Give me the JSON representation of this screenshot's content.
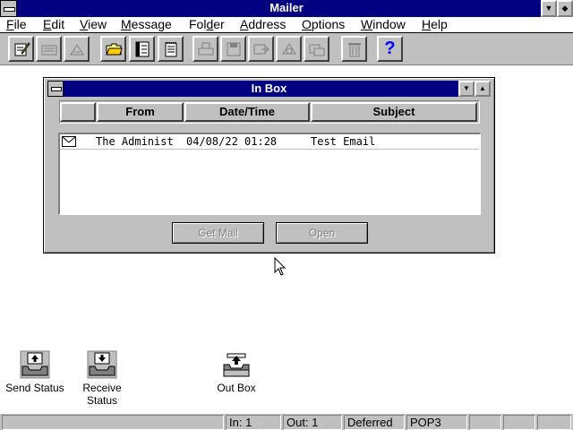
{
  "app": {
    "title": "Mailer"
  },
  "menu": [
    {
      "label": "File",
      "u": "F",
      "rest": "ile"
    },
    {
      "label": "Edit",
      "u": "E",
      "rest": "dit"
    },
    {
      "label": "View",
      "u": "V",
      "rest": "iew"
    },
    {
      "label": "Message",
      "u": "M",
      "rest": "essage"
    },
    {
      "label": "Folder",
      "u": "F",
      "pre": "Fol",
      "rest": "der"
    },
    {
      "label": "Address",
      "u": "A",
      "rest": "ddress"
    },
    {
      "label": "Options",
      "u": "O",
      "rest": "ptions"
    },
    {
      "label": "Window",
      "u": "W",
      "rest": "indow"
    },
    {
      "label": "Help",
      "u": "H",
      "rest": "elp"
    }
  ],
  "toolbar": {
    "icons": [
      "compose-icon",
      "reply-icon",
      "forward-icon",
      "open-folder-icon",
      "address-book-icon",
      "notepad-icon",
      "print-icon",
      "save-icon",
      "move-icon",
      "reply-all-icon",
      "undelete-icon",
      "trash-icon",
      "help-icon"
    ],
    "help_glyph": "?"
  },
  "inbox": {
    "title": "In Box",
    "columns": [
      "From",
      "Date/Time",
      "Subject"
    ],
    "messages": [
      {
        "from": "The Administ",
        "datetime": "04/08/22 01:28",
        "subject": "Test Email"
      }
    ],
    "get_mail_label": "Get Mail",
    "open_label": "Open"
  },
  "desktop_icons": [
    {
      "label": "Send Status"
    },
    {
      "label": "Receive Status"
    },
    {
      "label": "Out Box"
    }
  ],
  "status": {
    "in": "In: 1",
    "out": "Out: 1",
    "mode": "Deferred",
    "protocol": "POP3"
  },
  "colors": {
    "title_bar": "#000080",
    "face": "#c0c0c0",
    "help_blue": "#0000ff"
  }
}
